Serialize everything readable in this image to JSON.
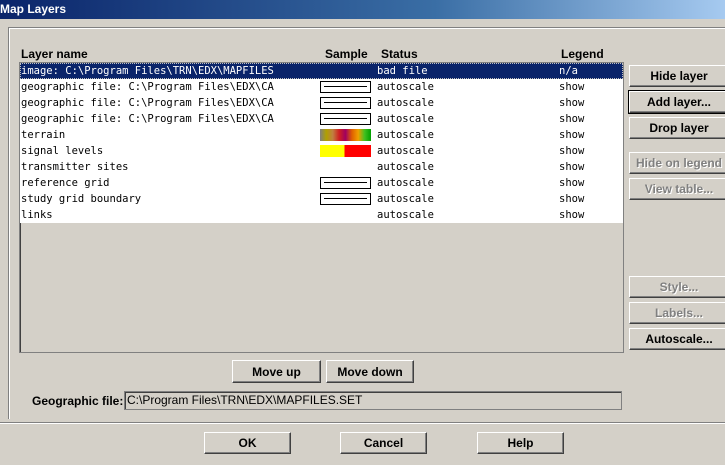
{
  "window": {
    "title": "Map Layers"
  },
  "columns": {
    "name": "Layer name",
    "sample": "Sample",
    "status": "Status",
    "legend": "Legend"
  },
  "layers": [
    {
      "name": "image: C:\\Program Files\\TRN\\EDX\\MAPFILES",
      "sample": "none",
      "status": "bad file",
      "legend": "n/a",
      "selected": true
    },
    {
      "name": "geographic file: C:\\Program Files\\EDX\\CA",
      "sample": "line",
      "status": "autoscale",
      "legend": "show"
    },
    {
      "name": "geographic file: C:\\Program Files\\EDX\\CA",
      "sample": "line",
      "status": "autoscale",
      "legend": "show"
    },
    {
      "name": "geographic file: C:\\Program Files\\EDX\\CA",
      "sample": "line",
      "status": "autoscale",
      "legend": "show"
    },
    {
      "name": "terrain",
      "sample": "terrain-gradient",
      "status": "autoscale",
      "legend": "show"
    },
    {
      "name": "signal levels",
      "sample": "signal-gradient",
      "status": "autoscale",
      "legend": "show"
    },
    {
      "name": "transmitter sites",
      "sample": "none",
      "status": "autoscale",
      "legend": "show"
    },
    {
      "name": "reference grid",
      "sample": "line",
      "status": "autoscale",
      "legend": "show"
    },
    {
      "name": "study grid boundary",
      "sample": "line",
      "status": "autoscale",
      "legend": "show"
    },
    {
      "name": "links",
      "sample": "none",
      "status": "autoscale",
      "legend": "show"
    }
  ],
  "side_buttons": {
    "hide_layer": "Hide layer",
    "add_layer": "Add layer...",
    "drop_layer": "Drop layer",
    "hide_on_legend": "Hide on legend",
    "view_table": "View table...",
    "style": "Style...",
    "labels": "Labels...",
    "autoscale": "Autoscale..."
  },
  "move_buttons": {
    "up": "Move up",
    "down": "Move down"
  },
  "geographic_file": {
    "label": "Geographic file:",
    "value": "C:\\Program Files\\TRN\\EDX\\MAPFILES.SET"
  },
  "footer": {
    "ok": "OK",
    "cancel": "Cancel",
    "help": "Help"
  },
  "colors": {
    "selection": "#0a246a",
    "face": "#d4d0c8",
    "terrain_gradient": [
      "#808080",
      "#b0a000",
      "#c08040",
      "#d02020",
      "#a00060",
      "#e06000",
      "#f0a000",
      "#40c020",
      "#00a000"
    ],
    "signal_gradient": [
      "#ffff00",
      "#ff0000"
    ]
  }
}
